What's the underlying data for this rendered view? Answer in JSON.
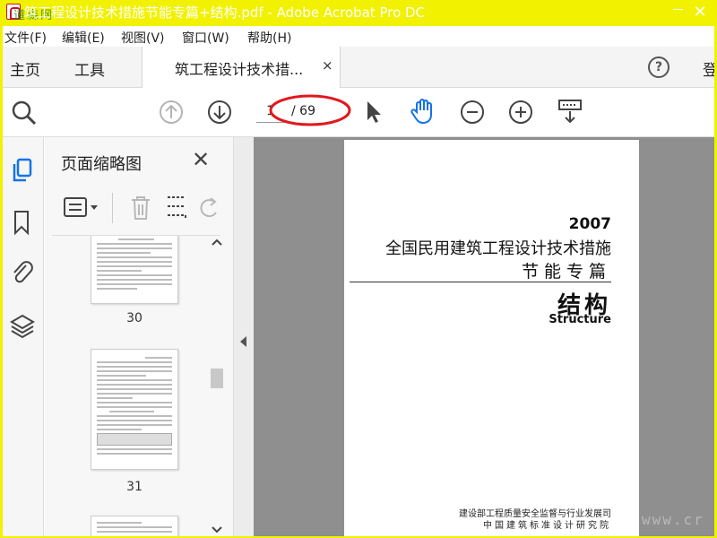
{
  "window": {
    "title": "筑工程设计技术措施节能专篇+结构.pdf - Adobe Acrobat Pro DC",
    "overlay_watermark": "道森网",
    "close_glyph": "✕"
  },
  "menu": [
    "文件(F)",
    "编辑(E)",
    "视图(V)",
    "窗口(W)",
    "帮助(H)"
  ],
  "tabs": {
    "home": "主页",
    "tools": "工具",
    "document": "筑工程设计技术措...",
    "close": "×",
    "help": "?",
    "signin": "登"
  },
  "toolbar": {
    "current_page": "1",
    "total_pages": "/ 69",
    "highlight_color": "#e0191e"
  },
  "sidebar": {
    "title": "页面缩略图",
    "close": "✕",
    "thumbnails": [
      {
        "page": "30"
      },
      {
        "page": "31"
      }
    ]
  },
  "document": {
    "year": "2007",
    "title_line1": "全国民用建筑工程设计技术措施",
    "title_line2": "节能专篇",
    "subject": "结构",
    "subject_en": "Structure",
    "publisher1": "建设部工程质量安全监督与行业发展司",
    "publisher2": "中国建筑标准设计研究院"
  },
  "watermark_corner": "www.cr",
  "colors": {
    "titlebar": "#f1f100",
    "accent_blue": "#1473e6",
    "page_bg": "#8f8f8f"
  },
  "icons": [
    "search-zoom-icon",
    "prev-page-icon",
    "next-page-icon",
    "select-cursor-icon",
    "hand-icon",
    "zoom-out-icon",
    "zoom-in-icon",
    "keyboard-page-icon",
    "thumbnails-icon",
    "bookmark-icon",
    "attachment-icon",
    "layers-icon",
    "options-icon",
    "trash-icon",
    "crop-icon",
    "rotate-icon"
  ]
}
